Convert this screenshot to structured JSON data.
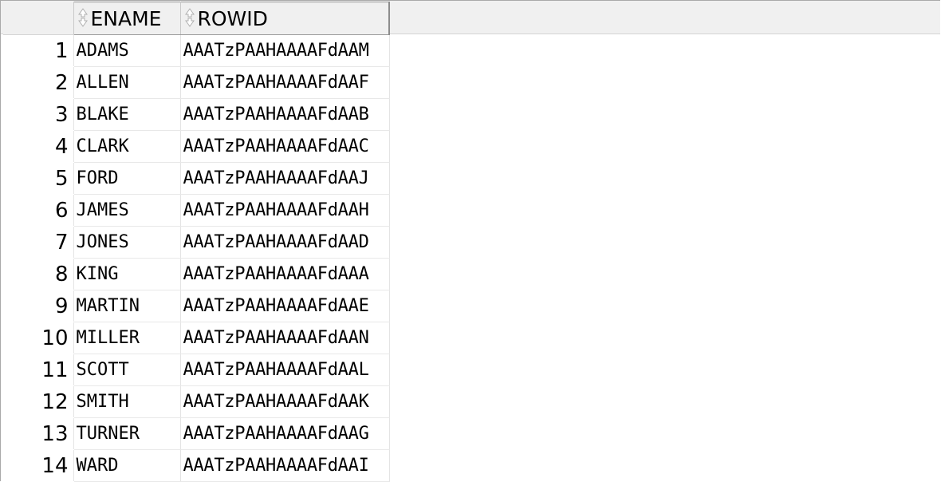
{
  "columns": [
    {
      "label": "ENAME",
      "icon": "sort-icon"
    },
    {
      "label": "ROWID",
      "icon": "sort-icon"
    }
  ],
  "rows": [
    {
      "num": "1",
      "ename": "ADAMS",
      "rowid": "AAATzPAAHAAAAFdAAM"
    },
    {
      "num": "2",
      "ename": "ALLEN",
      "rowid": "AAATzPAAHAAAAFdAAF"
    },
    {
      "num": "3",
      "ename": "BLAKE",
      "rowid": "AAATzPAAHAAAAFdAAB"
    },
    {
      "num": "4",
      "ename": "CLARK",
      "rowid": "AAATzPAAHAAAAFdAAC"
    },
    {
      "num": "5",
      "ename": "FORD",
      "rowid": "AAATzPAAHAAAAFdAAJ"
    },
    {
      "num": "6",
      "ename": "JAMES",
      "rowid": "AAATzPAAHAAAAFdAAH"
    },
    {
      "num": "7",
      "ename": "JONES",
      "rowid": "AAATzPAAHAAAAFdAAD"
    },
    {
      "num": "8",
      "ename": "KING",
      "rowid": "AAATzPAAHAAAAFdAAA"
    },
    {
      "num": "9",
      "ename": "MARTIN",
      "rowid": "AAATzPAAHAAAAFdAAE"
    },
    {
      "num": "10",
      "ename": "MILLER",
      "rowid": "AAATzPAAHAAAAFdAAN"
    },
    {
      "num": "11",
      "ename": "SCOTT",
      "rowid": "AAATzPAAHAAAAFdAAL"
    },
    {
      "num": "12",
      "ename": "SMITH",
      "rowid": "AAATzPAAHAAAAFdAAK"
    },
    {
      "num": "13",
      "ename": "TURNER",
      "rowid": "AAATzPAAHAAAAFdAAG"
    },
    {
      "num": "14",
      "ename": "WARD",
      "rowid": "AAATzPAAHAAAAFdAAI"
    }
  ]
}
